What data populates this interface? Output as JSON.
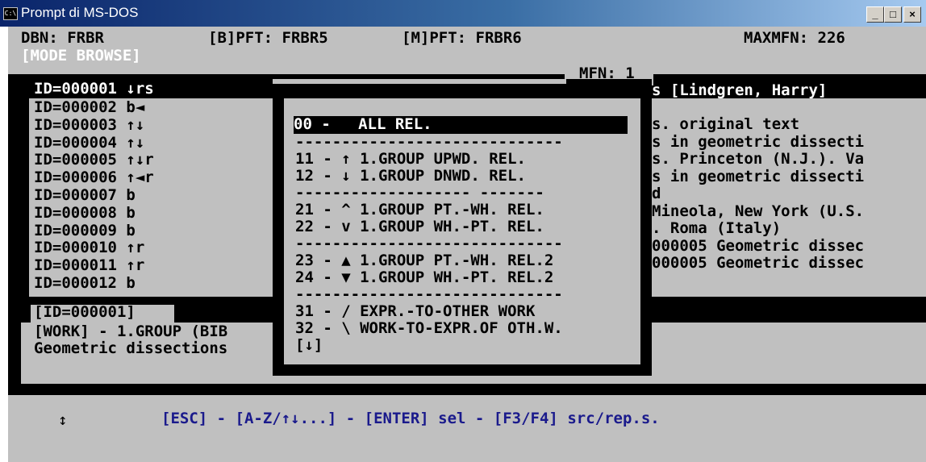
{
  "window": {
    "title": "Prompt di MS-DOS",
    "icon": "ms-dos-console-icon",
    "controls": [
      "_",
      "□",
      "×"
    ]
  },
  "status": {
    "dbn": "DBN: FRBR",
    "bpft": "[B]PFT: FRBR5",
    "mpft": "[M]PFT: FRBR6",
    "maxmfn": "MAXMFN: 226",
    "mode": "[MODE BROWSE]"
  },
  "mfn": "MFN: 1",
  "id_list": [
    "ID=000001 ↓rs",
    "ID=000002 b◄",
    "ID=000003 ↑↓",
    "ID=000004 ↑↓",
    "ID=000005 ↑↓r",
    "ID=000006 ↑◄r",
    "ID=000007 b",
    "ID=000008 b",
    "ID=000009 b",
    "ID=000010 ↑r",
    "ID=000011 ↑r",
    "ID=000012 b"
  ],
  "record_header": "s [Lindgren, Harry]",
  "record_lines": [
    "s. original text",
    "s in geometric dissecti",
    "s. Princeton (N.J.). Va",
    "s in geometric dissecti",
    "d",
    "Mineola, New York (U.S.",
    ". Roma (Italy)",
    "000005 Geometric dissec",
    "000005 Geometric dissec"
  ],
  "selected_id": "[ID=000001]",
  "detail_lines": [
    "[WORK] - 1.GROUP (BIB",
    "Geometric dissections"
  ],
  "menu": {
    "selected": "00 -   ALL REL.",
    "items": [
      "11 - ↑ 1.GROUP UPWD. REL.",
      "12 - ↓ 1.GROUP DNWD. REL.",
      "21 - ^ 1.GROUP PT.-WH. REL.",
      "22 - v 1.GROUP WH.-PT. REL.",
      "23 - ▲ 1.GROUP PT.-WH. REL.2",
      "24 - ▼ 1.GROUP WH.-PT. REL.2",
      "31 - / EXPR.-TO-OTHER WORK",
      "32 - \\ WORK-TO-EXPR.OF OTH.W."
    ],
    "separator": "-----------------------------",
    "separator_gap": "------------------- -------",
    "more": "[↓]"
  },
  "footer": "[ESC] - [A-Z/↑↓...] - [ENTER] sel - [F3/F4] src/rep.s.",
  "cursor_glyph": "↕"
}
